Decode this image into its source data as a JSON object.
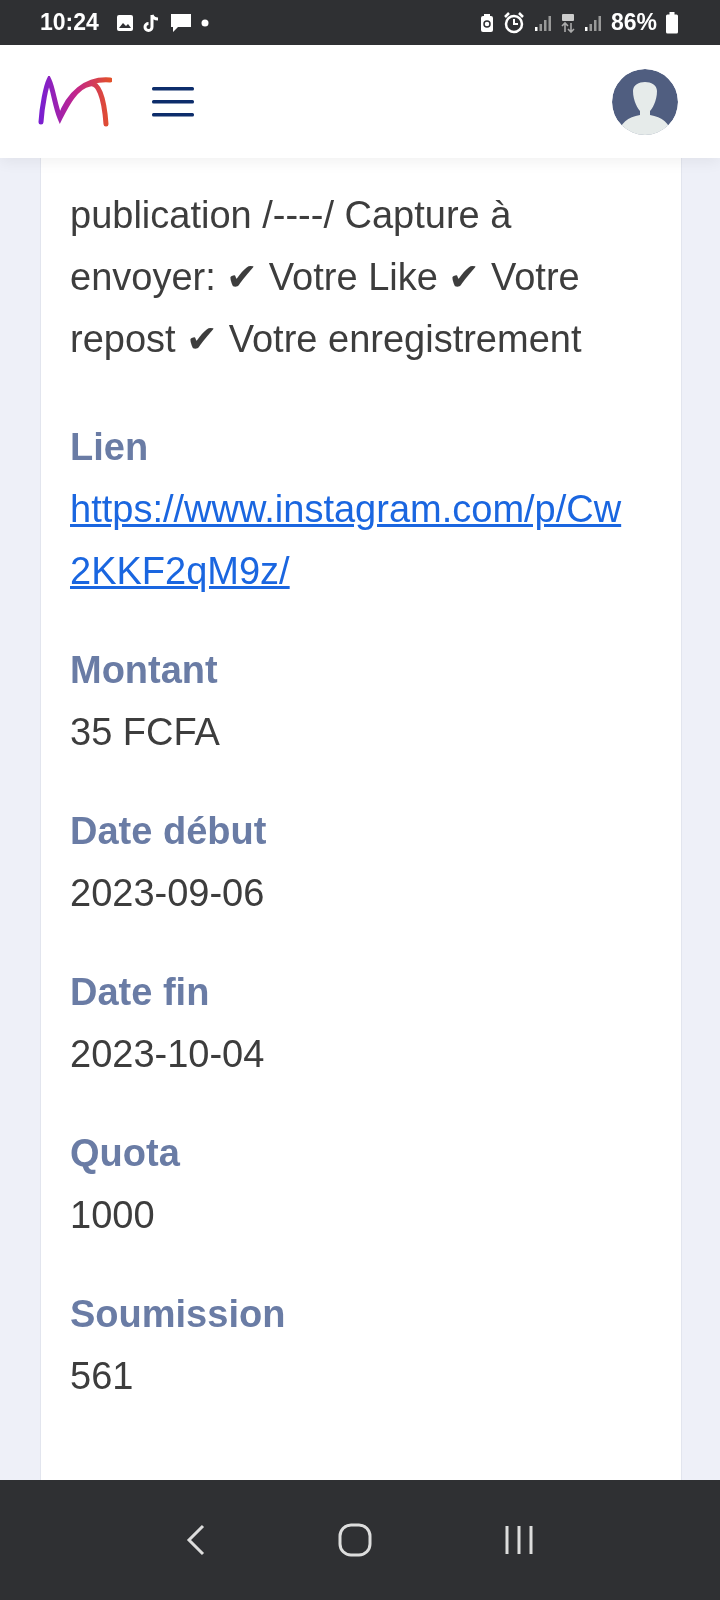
{
  "status_bar": {
    "time": "10:24",
    "battery": "86%"
  },
  "details": {
    "description": "publication /----/ Capture à envoyer: ✔ Votre Like ✔ Votre repost ✔ Votre enregistrement",
    "fields": [
      {
        "label": "Lien",
        "value": "https://www.instagram.com/p/Cw2KKF2qM9z/",
        "kind": "link"
      },
      {
        "label": "Montant",
        "value": "35 FCFA",
        "kind": "text"
      },
      {
        "label": "Date début",
        "value": "2023-09-06",
        "kind": "text"
      },
      {
        "label": "Date fin",
        "value": "2023-10-04",
        "kind": "text"
      },
      {
        "label": "Quota",
        "value": "1000",
        "kind": "text"
      },
      {
        "label": "Soumission",
        "value": "561",
        "kind": "text"
      }
    ]
  }
}
